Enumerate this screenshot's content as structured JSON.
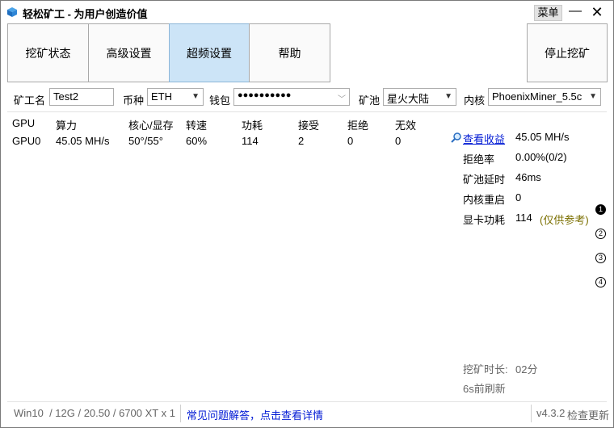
{
  "window": {
    "title": "轻松矿工 - 为用户创造价值",
    "menu_label": "菜单",
    "minimize_glyph": "—",
    "close_glyph": "✕"
  },
  "tabs": [
    {
      "label": "挖矿状态",
      "active": false
    },
    {
      "label": "高级设置",
      "active": false
    },
    {
      "label": "超频设置",
      "active": true
    },
    {
      "label": "帮助",
      "active": false
    }
  ],
  "stop_button": {
    "label": "停止挖矿"
  },
  "config": {
    "miner_name_label": "矿工名",
    "miner_name_value": "Test2",
    "coin_label": "币种",
    "coin_value": "ETH",
    "wallet_label": "钱包",
    "wallet_value": "●●●●●●●●●●",
    "pool_label": "矿池",
    "pool_value": "星火大陆",
    "kernel_label": "内核",
    "kernel_value": "PhoenixMiner_5.5c"
  },
  "gpu_table": {
    "headers": [
      "GPU",
      "算力",
      "核心/显存",
      "转速",
      "功耗",
      "接受",
      "拒绝",
      "无效"
    ],
    "rows": [
      [
        "GPU0",
        "45.05 MH/s",
        "50°/55°",
        "60%",
        "114",
        "2",
        "0",
        "0"
      ]
    ]
  },
  "stats": {
    "view_earnings_label": "查看收益",
    "hashrate_value": "45.05 MH/s",
    "reject_rate_label": "拒绝率",
    "reject_rate_value": "0.00%(0/2)",
    "pool_latency_label": "矿池延时",
    "pool_latency_value": "46ms",
    "kernel_restart_label": "内核重启",
    "kernel_restart_value": "0",
    "gpu_power_label": "显卡功耗",
    "gpu_power_value": "114",
    "gpu_power_note": "(仅供参考)"
  },
  "pager": [
    "1",
    "2",
    "3",
    "4"
  ],
  "mining_time": {
    "label": "挖矿时长:",
    "value": "02分"
  },
  "refresh_text": "6s前刷新",
  "footer": {
    "system_info": "Win10  / 12G / 20.50 / 6700 XT x 1",
    "faq_link": "常见问题解答，点击查看详情",
    "version": "v4.3.2",
    "update_link": "检查更新"
  },
  "colors": {
    "active_tab": "#cce4f7",
    "link": "#0019d4",
    "note": "#7b6f00"
  },
  "icons": {
    "app": "app-logo-icon",
    "search": "search-icon"
  }
}
